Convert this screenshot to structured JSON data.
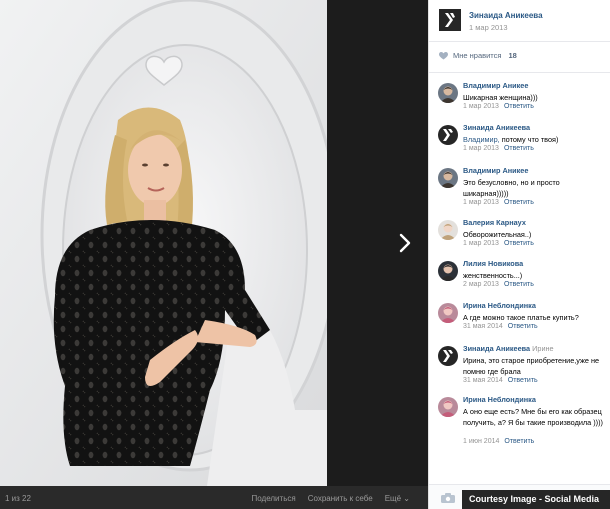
{
  "viewer": {
    "counter": "1 из 22",
    "actions": [
      "Поделиться",
      "Сохранить к себе",
      "Ещё ⌄"
    ]
  },
  "post": {
    "owner_name": "Зинаида Аникеева",
    "owner_date": "1 мар 2013",
    "likes_label": "Мне нравится",
    "likes_count": "18"
  },
  "comments": [
    {
      "author": "Владимир Аникее",
      "reply_to": "",
      "text": "Шикарная женщина)))",
      "mention": "",
      "date": "1 мар 2013",
      "reply": "Ответить",
      "avatar": "man-photo"
    },
    {
      "author": "Зинаида Аникеева",
      "reply_to": "",
      "mention": "Владимир,",
      "text": " потому что твоя)",
      "date": "1 мар 2013",
      "reply": "Ответить",
      "avatar": "logo-icon"
    },
    {
      "author": "Владимир Аникее",
      "reply_to": "",
      "mention": "",
      "text": "Это безусловно, но и просто шикарная)))))",
      "date": "1 мар 2013",
      "reply": "Ответить",
      "avatar": "man-photo"
    },
    {
      "author": "Валерия Карнаух",
      "reply_to": "",
      "mention": "",
      "text": "Обворожительная..)",
      "date": "1 мар 2013",
      "reply": "Ответить",
      "avatar": "woman-photo-light"
    },
    {
      "author": "Лилия Новикова",
      "reply_to": "",
      "mention": "",
      "text": "женственность...)",
      "date": "2 мар 2013",
      "reply": "Ответить",
      "avatar": "woman-photo-dark"
    },
    {
      "author": "Ирина Неблондинка",
      "reply_to": "",
      "mention": "",
      "text": "А где можно такое платье купить?",
      "date": "31 мая 2014",
      "reply": "Ответить",
      "avatar": "woman-photo-pink"
    },
    {
      "author": "Зинаида Аникеева",
      "reply_to": "Ирине",
      "mention": "",
      "text": "Ирина, это старое приобретение,уже не помню где брала",
      "date": "31 мая 2014",
      "reply": "Ответить",
      "avatar": "logo-icon"
    },
    {
      "author": "Ирина Неблондинка",
      "reply_to": "",
      "mention": "",
      "text": "А оно еще есть? Мне бы его как образец получить, а? Я бы такие производила ))))",
      "date": "1 июн 2014",
      "reply": "Ответить",
      "avatar": "woman-photo-pink"
    }
  ],
  "caption": "Courtesy Image - Social Media",
  "colors": {
    "link": "#2a5885",
    "meta": "#939393",
    "viewer_bg": "#1c1c1c"
  }
}
